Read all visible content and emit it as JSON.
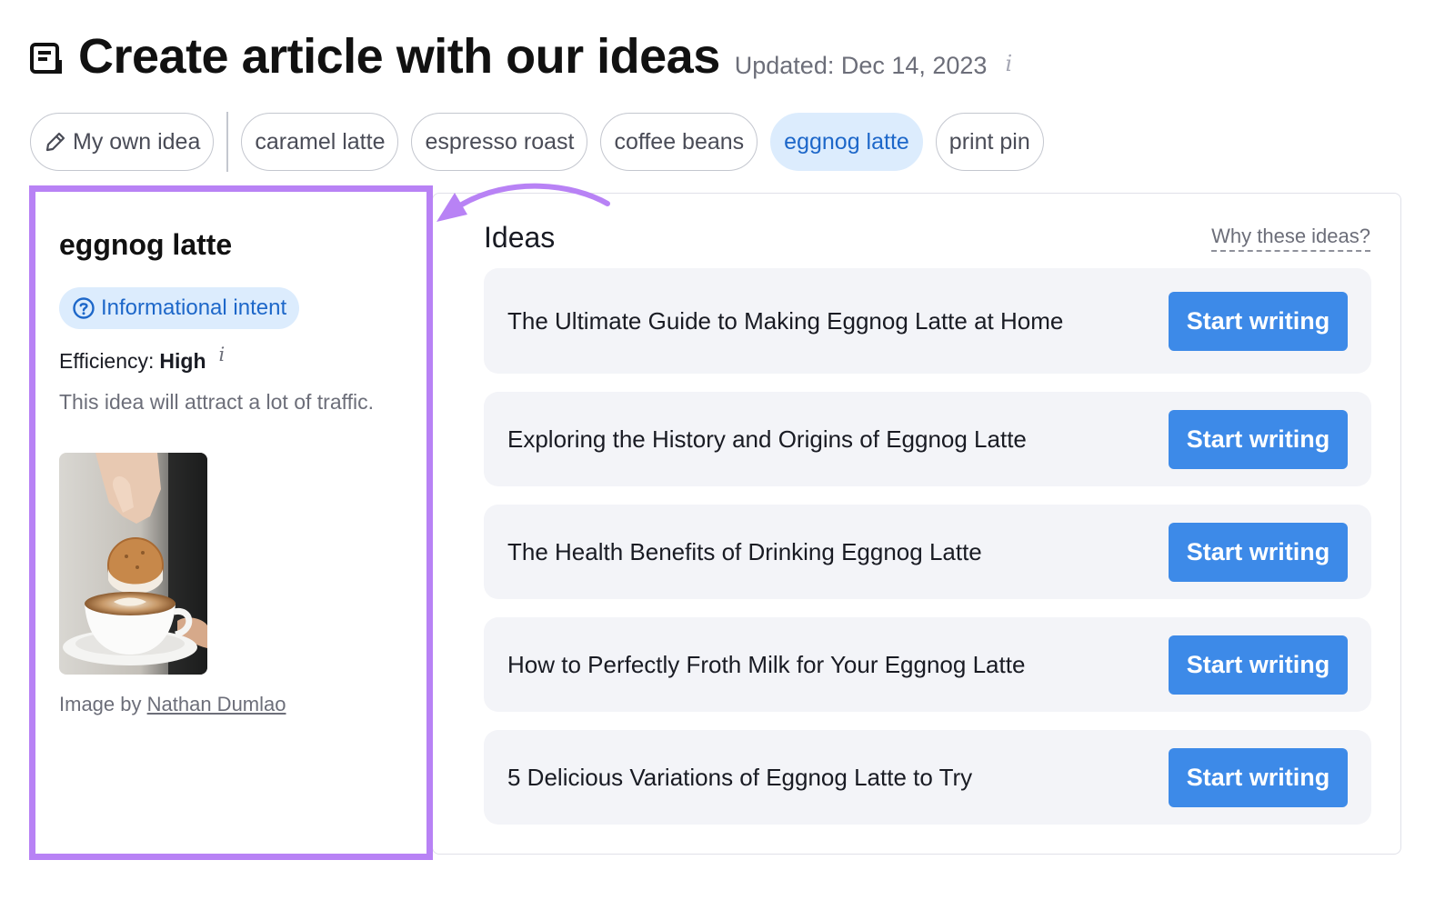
{
  "header": {
    "icon": "article-icon",
    "title": "Create article with our ideas",
    "updated": "Updated: Dec 14, 2023",
    "info_icon": "i"
  },
  "chips": {
    "own_idea": {
      "label": "My own idea",
      "icon": "pencil-icon"
    },
    "keywords": [
      {
        "label": "caramel latte",
        "active": false
      },
      {
        "label": "espresso roast",
        "active": false
      },
      {
        "label": "coffee beans",
        "active": false
      },
      {
        "label": "eggnog latte",
        "active": true
      },
      {
        "label": "print pin",
        "active": false
      }
    ]
  },
  "keyword_panel": {
    "title": "eggnog latte",
    "intent": "Informational intent",
    "efficiency_label": "Efficiency:",
    "efficiency_value": "High",
    "info_icon": "i",
    "efficiency_desc": "This idea will attract a lot of traffic.",
    "credit_prefix": "Image by",
    "credit_author": "Nathan Dumlao"
  },
  "ideas": {
    "title": "Ideas",
    "why_link": "Why these ideas?",
    "items": [
      {
        "text": "The Ultimate Guide to Making Eggnog Latte at Home",
        "button": "Start writing"
      },
      {
        "text": "Exploring the History and Origins of Eggnog Latte",
        "button": "Start writing"
      },
      {
        "text": "The Health Benefits of Drinking Eggnog Latte",
        "button": "Start writing"
      },
      {
        "text": "How to Perfectly Froth Milk for Your Eggnog Latte",
        "button": "Start writing"
      },
      {
        "text": "5 Delicious Variations of Eggnog Latte to Try",
        "button": "Start writing"
      }
    ]
  },
  "colors": {
    "highlight_border": "#b882f5",
    "accent_blue": "#3d8ae8",
    "active_chip_bg": "#dcecfd",
    "card_bg": "#f3f4f8"
  }
}
